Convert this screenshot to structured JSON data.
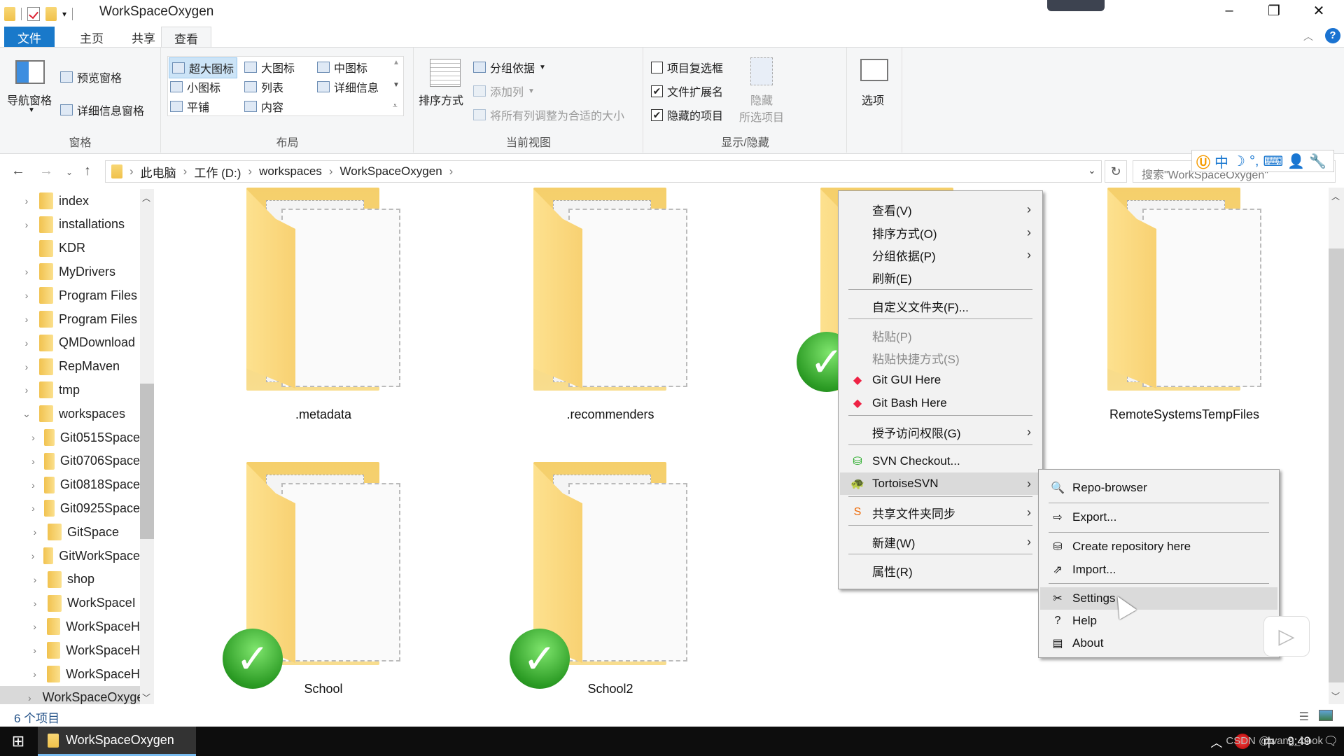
{
  "window": {
    "title": "WorkSpaceOxygen",
    "controls": {
      "minimize": "–",
      "maximize": "❐",
      "close": "✕"
    }
  },
  "ribbon_tabs": [
    {
      "label": "文件"
    },
    {
      "label": "主页"
    },
    {
      "label": "共享"
    },
    {
      "label": "查看",
      "active": true
    }
  ],
  "ribbon": {
    "panes": {
      "group_label": "窗格",
      "nav_pane": "导航窗格",
      "preview_pane": "预览窗格",
      "details_pane": "详细信息窗格"
    },
    "layout": {
      "group_label": "布局",
      "items": [
        "超大图标",
        "大图标",
        "中图标",
        "小图标",
        "列表",
        "详细信息",
        "平铺",
        "内容"
      ],
      "selected": "超大图标"
    },
    "current_view": {
      "group_label": "当前视图",
      "sort_by": "排序方式",
      "group_by": "分组依据",
      "add_columns": "添加列",
      "fit_columns": "将所有列调整为合适的大小"
    },
    "show_hide": {
      "group_label": "显示/隐藏",
      "item_checkboxes": {
        "label": "项目复选框",
        "checked": false
      },
      "file_extensions": {
        "label": "文件扩展名",
        "checked": true
      },
      "hidden_items": {
        "label": "隐藏的项目",
        "checked": true
      },
      "hide_selected_line1": "隐藏",
      "hide_selected_line2": "所选项目"
    },
    "options": {
      "label": "选项"
    }
  },
  "address_bar": {
    "breadcrumb": [
      "此电脑",
      "工作 (D:)",
      "workspaces",
      "WorkSpaceOxygen"
    ],
    "search_placeholder": "搜索\"WorkSpaceOxygen\""
  },
  "ime_toolbar": {
    "mode": "中"
  },
  "nav_tree": [
    {
      "label": "index",
      "expandable": true,
      "level": 0
    },
    {
      "label": "installations",
      "expandable": true,
      "level": 0
    },
    {
      "label": "KDR",
      "expandable": false,
      "level": 0
    },
    {
      "label": "MyDrivers",
      "expandable": true,
      "level": 0
    },
    {
      "label": "Program Files",
      "expandable": true,
      "level": 0
    },
    {
      "label": "Program Files",
      "expandable": true,
      "level": 0
    },
    {
      "label": "QMDownload",
      "expandable": true,
      "level": 0
    },
    {
      "label": "RepMaven",
      "expandable": true,
      "level": 0
    },
    {
      "label": "tmp",
      "expandable": true,
      "level": 0
    },
    {
      "label": "workspaces",
      "expandable": true,
      "expanded": true,
      "level": 0
    },
    {
      "label": "Git0515Space",
      "expandable": true,
      "level": 1
    },
    {
      "label": "Git0706Space",
      "expandable": true,
      "level": 1
    },
    {
      "label": "Git0818Space",
      "expandable": true,
      "level": 1
    },
    {
      "label": "Git0925Space",
      "expandable": true,
      "level": 1
    },
    {
      "label": "GitSpace",
      "expandable": true,
      "level": 1
    },
    {
      "label": "GitWorkSpace",
      "expandable": true,
      "level": 1
    },
    {
      "label": "shop",
      "expandable": true,
      "level": 1
    },
    {
      "label": "WorkSpaceI",
      "expandable": true,
      "level": 1
    },
    {
      "label": "WorkSpaceH",
      "expandable": true,
      "level": 1
    },
    {
      "label": "WorkSpaceH",
      "expandable": true,
      "level": 1
    },
    {
      "label": "WorkSpaceH",
      "expandable": true,
      "level": 1
    },
    {
      "label": "WorkSpaceOxygen",
      "expandable": true,
      "level": 1,
      "selected": true
    }
  ],
  "files": [
    {
      "name": ".metadata",
      "svn_ok": false
    },
    {
      "name": ".recommenders",
      "svn_ok": false
    },
    {
      "name": "",
      "svn_ok": true
    },
    {
      "name": "RemoteSystemsTempFiles",
      "svn_ok": false
    },
    {
      "name": "School",
      "svn_ok": true
    },
    {
      "name": "School2",
      "svn_ok": true
    }
  ],
  "context_menu": {
    "items": [
      {
        "label": "查看(V)",
        "submenu": true
      },
      {
        "label": "排序方式(O)",
        "submenu": true
      },
      {
        "label": "分组依据(P)",
        "submenu": true
      },
      {
        "label": "刷新(E)"
      },
      {
        "label": "自定义文件夹(F)..."
      },
      {
        "label": "粘贴(P)",
        "disabled": true
      },
      {
        "label": "粘贴快捷方式(S)",
        "disabled": true
      },
      {
        "label": "Git GUI Here",
        "icon": "git-icon"
      },
      {
        "label": "Git Bash Here",
        "icon": "git-icon"
      },
      {
        "label": "授予访问权限(G)",
        "submenu": true
      },
      {
        "label": "SVN Checkout...",
        "icon": "svn-checkout-icon"
      },
      {
        "label": "TortoiseSVN",
        "icon": "tortoise-icon",
        "submenu": true,
        "highlighted": true
      },
      {
        "label": "共享文件夹同步",
        "icon": "sync-icon",
        "submenu": true
      },
      {
        "label": "新建(W)",
        "submenu": true
      },
      {
        "label": "属性(R)"
      }
    ]
  },
  "svn_submenu": {
    "items": [
      {
        "label": "Repo-browser",
        "icon": "repo-browser-icon"
      },
      {
        "label": "Export...",
        "icon": "export-icon"
      },
      {
        "label": "Create repository here",
        "icon": "create-repo-icon"
      },
      {
        "label": "Import...",
        "icon": "import-icon"
      },
      {
        "label": "Settings",
        "icon": "settings-icon",
        "highlighted": true
      },
      {
        "label": "Help",
        "icon": "help-icon"
      },
      {
        "label": "About",
        "icon": "about-icon"
      }
    ]
  },
  "status_bar": {
    "item_count": "6 个项目"
  },
  "taskbar": {
    "task_label": "WorkSpaceOxygen",
    "ime": "中",
    "time": "9:49"
  },
  "watermark": "CSDN @wang_book"
}
